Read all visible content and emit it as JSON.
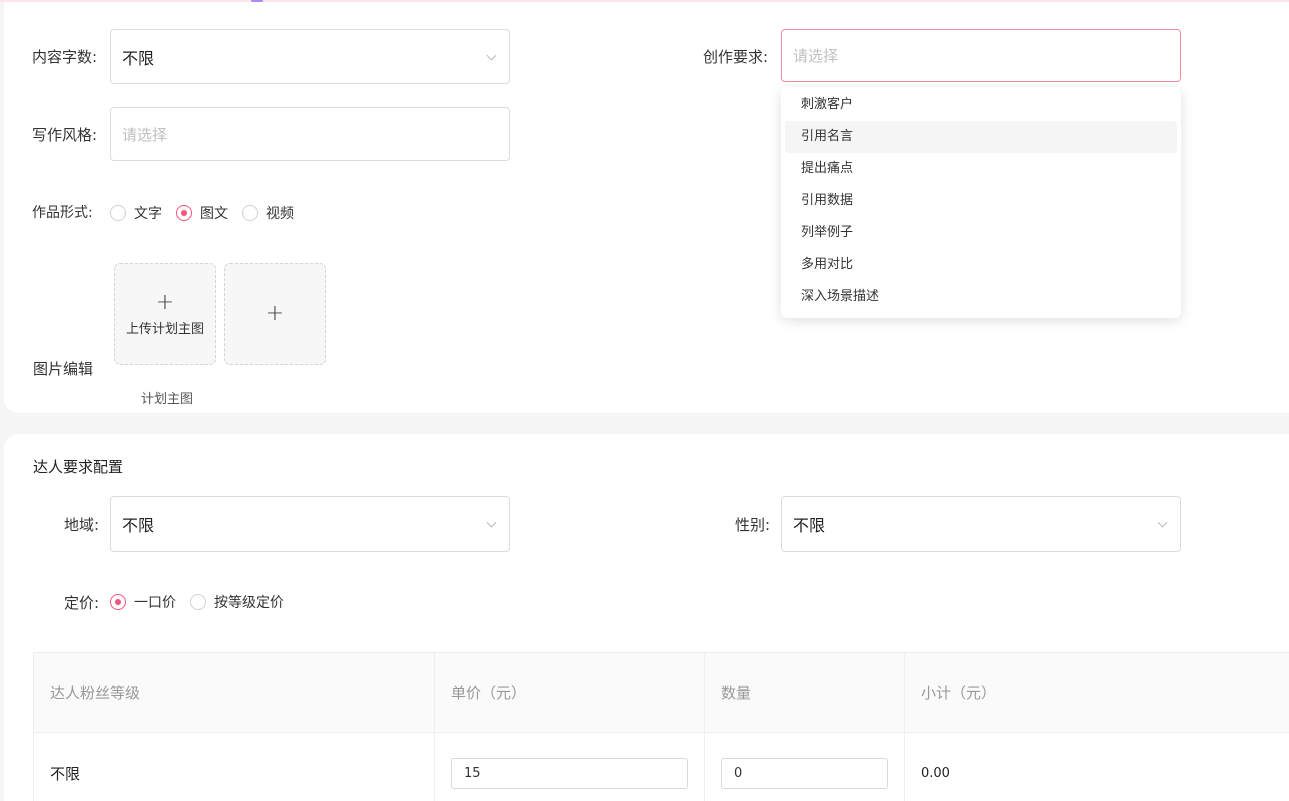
{
  "form": {
    "content_words": {
      "label": "内容字数:",
      "value": "不限"
    },
    "creation_req": {
      "label": "创作要求:",
      "placeholder": "请选择"
    },
    "writing_style": {
      "label": "写作风格:",
      "placeholder": "请选择"
    },
    "work_format": {
      "label": "作品形式:",
      "options": [
        "文字",
        "图文",
        "视频"
      ],
      "selected": "图文"
    },
    "image_edit": {
      "label": "图片编辑",
      "upload_label": "上传计划主图",
      "caption": "计划主图",
      "plus_symbol": "+"
    }
  },
  "dropdown": {
    "options": [
      "刺激客户",
      "引用名言",
      "提出痛点",
      "引用数据",
      "列举例子",
      "多用对比",
      "深入场景描述"
    ],
    "hovered": "引用名言"
  },
  "influencer": {
    "section_title": "达人要求配置",
    "region": {
      "label": "地域:",
      "value": "不限"
    },
    "gender": {
      "label": "性别:",
      "value": "不限"
    },
    "pricing": {
      "label": "定价:",
      "options": [
        "一口价",
        "按等级定价"
      ],
      "selected": "一口价"
    }
  },
  "table": {
    "headers": [
      "达人粉丝等级",
      "单价（元）",
      "数量",
      "小计（元）"
    ],
    "rows": [
      {
        "level": "不限",
        "price": "15",
        "quantity": "0",
        "subtotal": "0.00"
      }
    ]
  },
  "colors": {
    "accent": "#f0557a",
    "focus_border": "#f08a9e"
  }
}
